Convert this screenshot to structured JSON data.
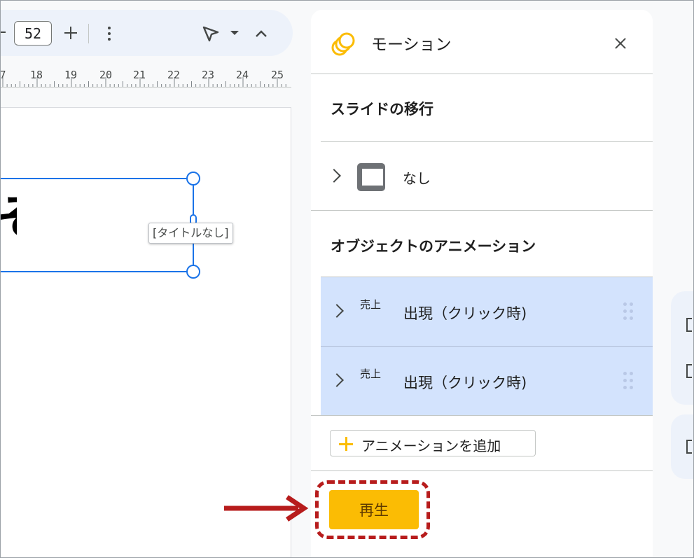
{
  "toolbar": {
    "zoom_value": "52",
    "icons": [
      "minus-icon",
      "plus-icon",
      "more-vert-icon",
      "select-cursor-icon",
      "dropdown-caret-icon",
      "collapse-chevron-icon"
    ]
  },
  "ruler": {
    "partial_left": "7",
    "numbers": [
      "18",
      "19",
      "20",
      "21",
      "22",
      "23",
      "24",
      "25"
    ]
  },
  "slide": {
    "placeholder_tooltip": "[タイトルなし]",
    "text_glyph": "そ"
  },
  "motion_panel": {
    "title": "モーション",
    "close_icon": "close-icon",
    "slide_transition_section": "スライドの移行",
    "transition_value": "なし",
    "object_animation_section": "オブジェクトのアニメーション",
    "animations": [
      {
        "target": "売上",
        "label": "出現（クリック時)"
      },
      {
        "target": "売上",
        "label": "出現（クリック時)"
      }
    ],
    "add_animation_label": "アニメーションを追加",
    "play_label": "再生"
  },
  "colors": {
    "selection_blue": "#1a73e8",
    "animation_row_bg": "#d3e3fd",
    "play_button": "#fbbc04",
    "annotation_red": "#b71c1c"
  }
}
